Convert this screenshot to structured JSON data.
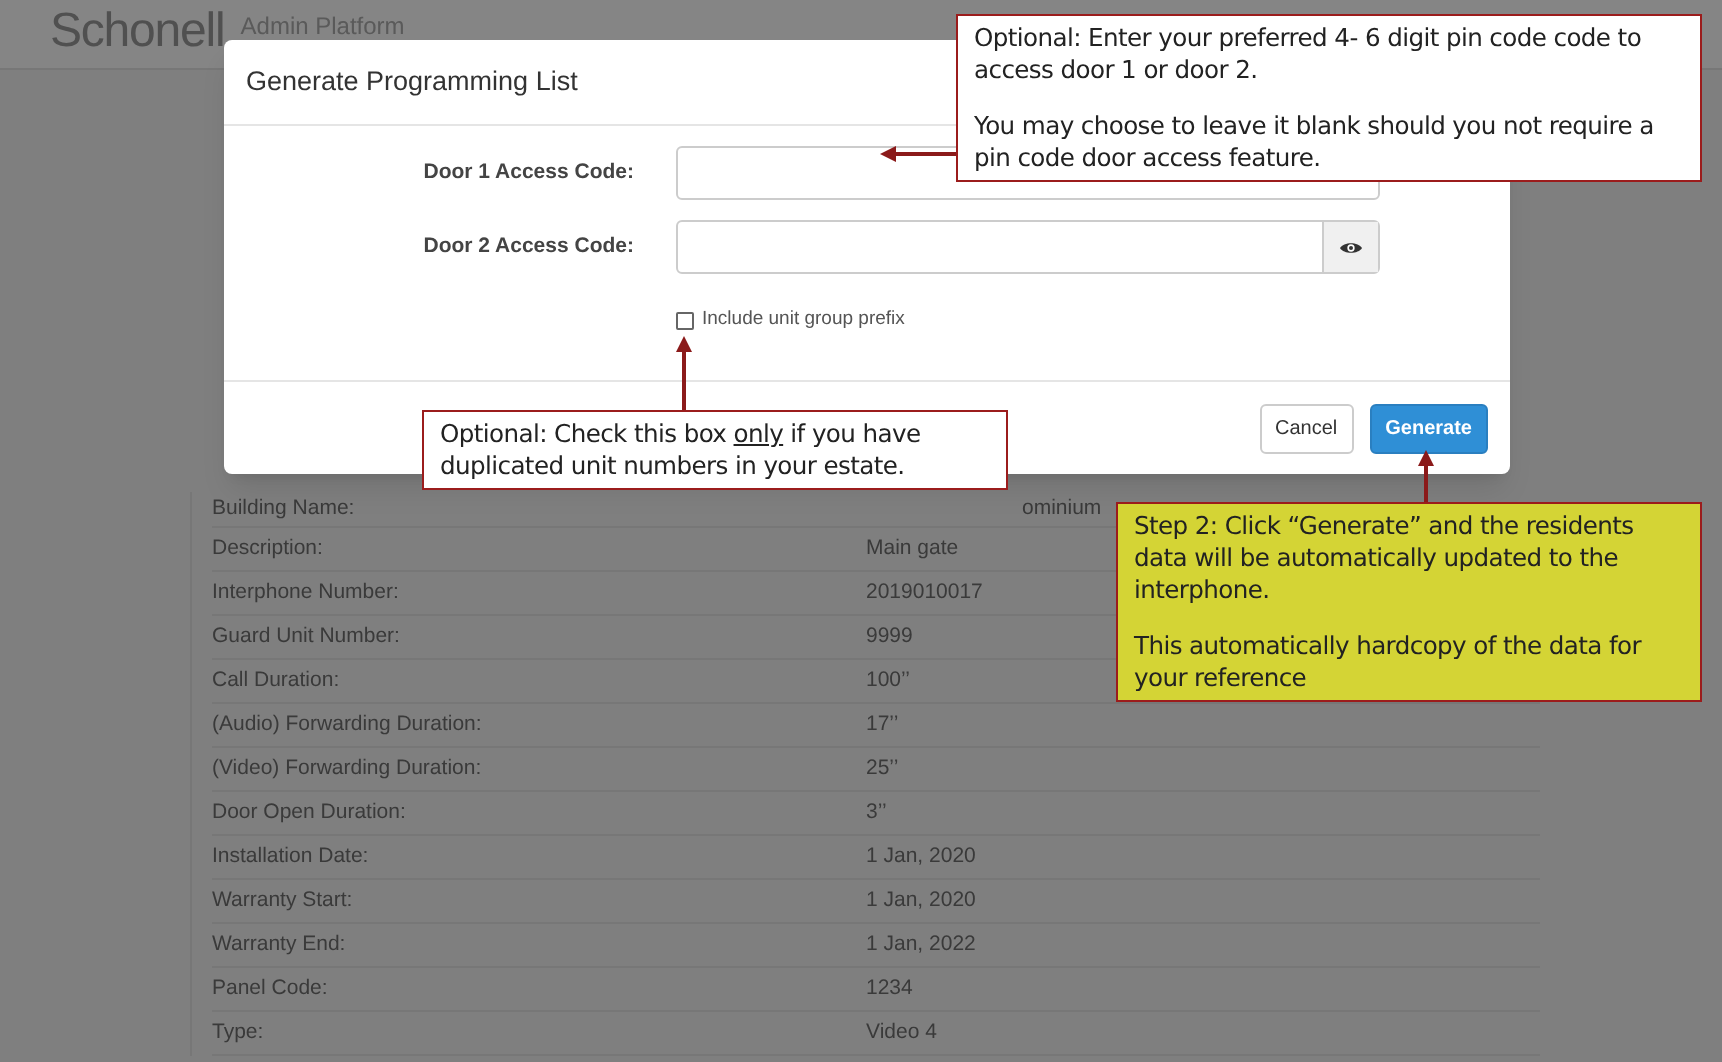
{
  "header": {
    "logo": "Schonell",
    "subtitle": "Admin Platform"
  },
  "details": [
    {
      "label": "Building Name:",
      "value": "ominium"
    },
    {
      "label": "Description:",
      "value": "Main gate"
    },
    {
      "label": "Interphone Number:",
      "value": "2019010017"
    },
    {
      "label": "Guard Unit Number:",
      "value": "9999"
    },
    {
      "label": "Call Duration:",
      "value": "100’’"
    },
    {
      "label": "(Audio) Forwarding Duration:",
      "value": "17’’"
    },
    {
      "label": "(Video) Forwarding Duration:",
      "value": "25’’"
    },
    {
      "label": "Door Open Duration:",
      "value": "3’’"
    },
    {
      "label": "Installation Date:",
      "value": "1 Jan, 2020"
    },
    {
      "label": "Warranty Start:",
      "value": "1 Jan, 2020"
    },
    {
      "label": "Warranty End:",
      "value": "1 Jan, 2022"
    },
    {
      "label": "Panel Code:",
      "value": "1234"
    },
    {
      "label": "Type:",
      "value": "Video 4"
    }
  ],
  "modal": {
    "title": "Generate Programming List",
    "fields": [
      {
        "label": "Door 1 Access Code:",
        "show_toggle": false
      },
      {
        "label": "Door 2 Access Code:",
        "show_toggle": true
      }
    ],
    "checkbox": {
      "label": "Include unit group prefix",
      "checked": false
    },
    "buttons": [
      {
        "label": "Cancel",
        "kind": "default"
      },
      {
        "label": "Generate",
        "kind": "primary"
      }
    ]
  },
  "callouts": [
    {
      "kind": "white",
      "paragraphs": [
        [
          {
            "text": "Optional: Enter your preferred 4- 6 digit pin code code to access door 1 or door 2.",
            "underline": false
          }
        ],
        [
          {
            "text": "You may choose to leave it blank should you not require a pin code door access feature.",
            "underline": false
          }
        ]
      ]
    },
    {
      "kind": "white",
      "paragraphs": [
        [
          {
            "text": "Optional: Check this box ",
            "underline": false
          },
          {
            "text": "only",
            "underline": true
          },
          {
            "text": " if you have duplicated unit numbers in your estate.",
            "underline": false
          }
        ]
      ]
    },
    {
      "kind": "yellow",
      "paragraphs": [
        [
          {
            "text": "Step 2: Click “Generate” and the residents data will be automatically updated to the interphone.",
            "underline": false
          }
        ],
        [
          {
            "text": "This automatically hardcopy of the data for your reference",
            "underline": false
          }
        ]
      ]
    }
  ]
}
